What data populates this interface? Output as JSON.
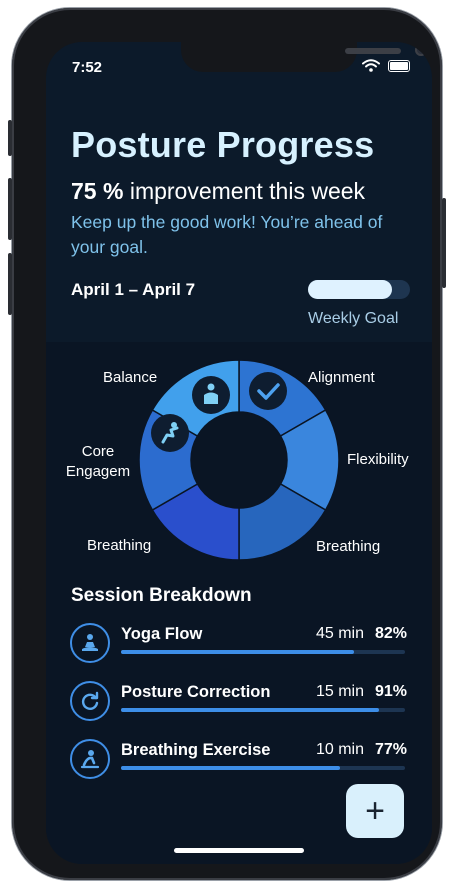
{
  "status": {
    "time": "7:52"
  },
  "header": {
    "title": "Posture Progress",
    "improvement_value": "75 %",
    "improvement_text": "improvement this week",
    "encouragement": "Keep up the good work! You’re ahead of your goal."
  },
  "week": {
    "range": "April 1 – April 7",
    "goal_label": "Weekly Goal",
    "goal_progress": 0.82
  },
  "chart": {
    "labels": {
      "balance": "Balance",
      "alignment": "Alignment",
      "core": "Core\nEngagem",
      "flexibility": "Flexibility",
      "breathing_left": "Breathing",
      "breathing_right": "Breathing"
    }
  },
  "chart_data": {
    "type": "pie",
    "categories": [
      "Alignment",
      "Flexibility",
      "Breathing",
      "Breathing",
      "Core Engagem",
      "Balance"
    ],
    "values": [
      1,
      1,
      1,
      1,
      1,
      1
    ]
  },
  "sessions_section": {
    "title": "Session Breakdown"
  },
  "sessions": [
    {
      "name": "Yoga Flow",
      "duration": "45 min",
      "percent": "82%",
      "progress": 0.82,
      "icon": "meditation-icon"
    },
    {
      "name": "Posture Correction",
      "duration": "15 min",
      "percent": "91%",
      "progress": 0.91,
      "icon": "refresh-icon"
    },
    {
      "name": "Breathing Exercise",
      "duration": "10 min",
      "percent": "77%",
      "progress": 0.77,
      "icon": "breathing-icon"
    }
  ],
  "fab": {
    "label": "+"
  },
  "colors": {
    "accent": "#3d8ee8",
    "title": "#d7f1ff",
    "background": "#0c1a2a"
  }
}
